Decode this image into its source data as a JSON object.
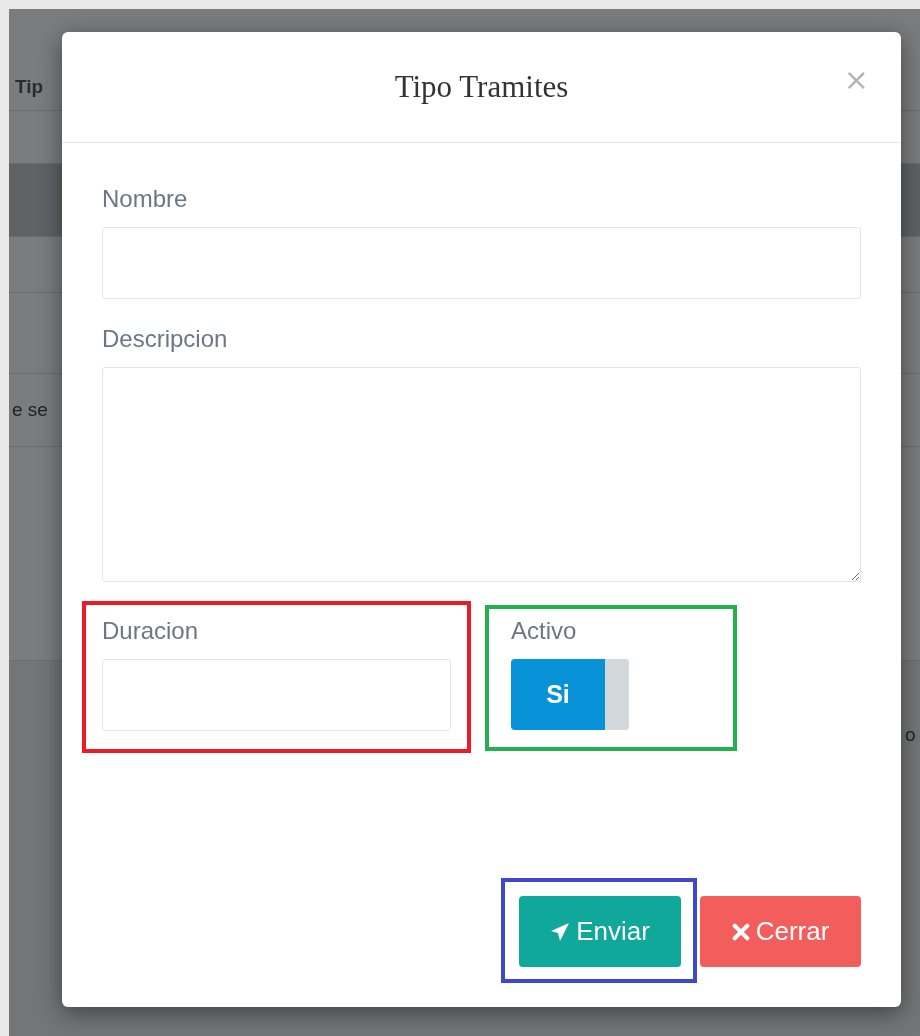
{
  "background_page": {
    "table_header": "Tip",
    "rows": [
      {
        "selected": false
      },
      {
        "selected": true
      },
      {
        "selected": false
      },
      {
        "selected": false
      },
      {
        "text": "e se",
        "selected": false
      }
    ],
    "side_text": "o"
  },
  "modal": {
    "title": "Tipo Tramites",
    "close": "×",
    "fields": [
      {
        "kind": "input",
        "label": "Nombre"
      },
      {
        "kind": "textarea",
        "label": "Descripcion"
      }
    ],
    "duracion": {
      "label": "Duracion",
      "color": "#ed1c24"
    },
    "activo": {
      "label": "Activo",
      "toggle_text": "Si",
      "on": true,
      "color": "#22b14c"
    },
    "buttons": [
      {
        "kind": "submit",
        "label": "Enviar",
        "color": "#3f48cc"
      },
      {
        "kind": "close",
        "label": "Cerrar"
      }
    ]
  }
}
